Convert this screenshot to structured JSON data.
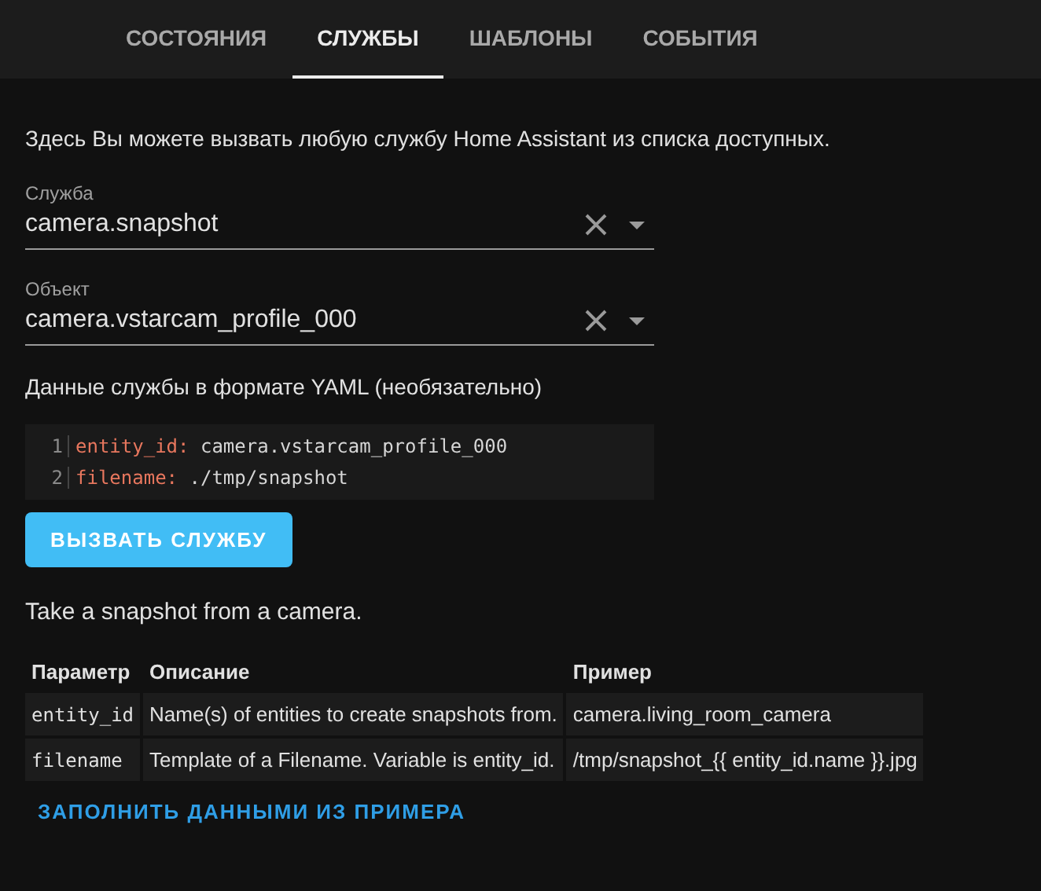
{
  "tabs": [
    {
      "label": "СОСТОЯНИЯ",
      "selected": false
    },
    {
      "label": "СЛУЖБЫ",
      "selected": true
    },
    {
      "label": "ШАБЛОНЫ",
      "selected": false
    },
    {
      "label": "СОБЫТИЯ",
      "selected": false
    }
  ],
  "intro": "Здесь Вы можете вызвать любую службу Home Assistant из списка доступных.",
  "fields": [
    {
      "label": "Служба",
      "value": "camera.snapshot"
    },
    {
      "label": "Объект",
      "value": "camera.vstarcam_profile_000"
    }
  ],
  "yaml": {
    "label": "Данные службы в формате YAML (необязательно)",
    "lines": [
      {
        "number": "1",
        "key": "entity_id:",
        "value": "camera.vstarcam_profile_000"
      },
      {
        "number": "2",
        "key": "filename:",
        "value": "./tmp/snapshot"
      }
    ]
  },
  "call_button": "ВЫЗВАТЬ СЛУЖБУ",
  "service_description": "Take a snapshot from a camera.",
  "table": {
    "columns": [
      "Параметр",
      "Описание",
      "Пример"
    ],
    "rows": [
      [
        "entity_id",
        "Name(s) of entities to create snapshots from.",
        "camera.living_room_camera"
      ],
      [
        "filename",
        "Template of a Filename. Variable is entity_id.",
        "/tmp/snapshot_{{ entity_id.name }}.jpg"
      ]
    ]
  },
  "fill_link": "ЗАПОЛНИТЬ ДАННЫМИ ИЗ ПРИМЕРА"
}
